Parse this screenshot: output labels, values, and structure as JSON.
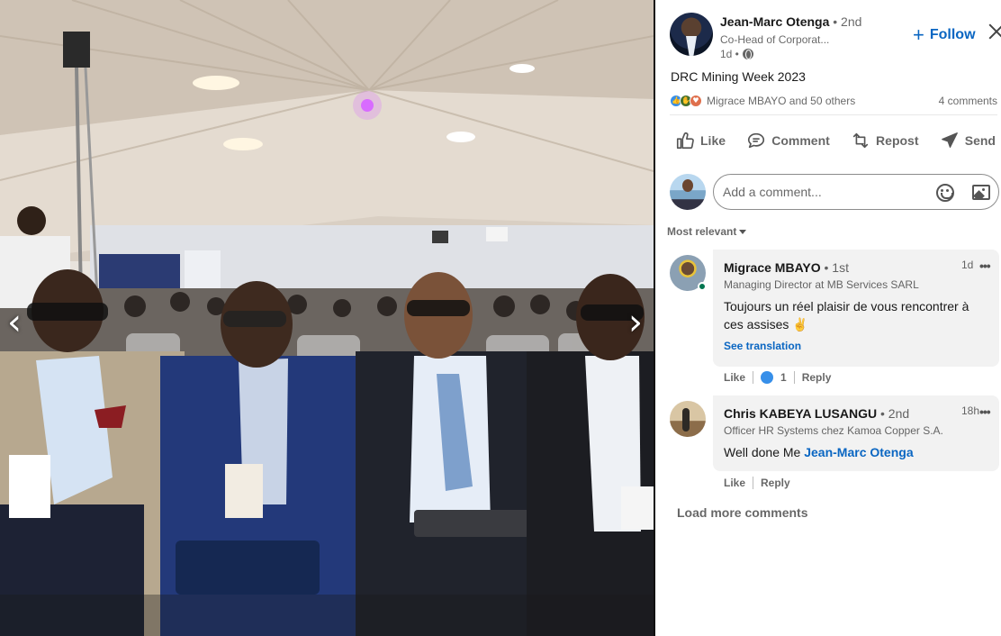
{
  "post": {
    "author_name": "Jean-Marc Otenga",
    "author_degree": "• 2nd",
    "author_title": "Co-Head of Corporat...",
    "time": "1d •",
    "follow_label": "Follow",
    "text": "DRC Mining Week 2023",
    "reactions_names": "Migrace MBAYO and 50 others",
    "comments_count": "4 comments"
  },
  "actions": {
    "like": "Like",
    "comment": "Comment",
    "repost": "Repost",
    "send": "Send"
  },
  "add_comment": {
    "placeholder": "Add a comment..."
  },
  "sort_label": "Most relevant",
  "comments": [
    {
      "name": "Migrace MBAYO",
      "degree": "• 1st",
      "headline": "Managing Director at MB Services SARL",
      "time": "1d",
      "text": "Toujours un réel plaisir de vous rencontrer à ces assises ✌",
      "see_translation": "See translation",
      "like_label": "Like",
      "like_count": "1",
      "reply_label": "Reply"
    },
    {
      "name": "Chris KABEYA LUSANGU",
      "degree": "• 2nd",
      "headline": "Officer HR Systems chez Kamoa Copper S.A.",
      "time": "18h",
      "text_prefix": "Well done Me",
      "mention": "Jean-Marc Otenga",
      "like_label": "Like",
      "reply_label": "Reply"
    }
  ],
  "load_more": "Load more comments",
  "nav": {
    "prev": "‹",
    "next": "›"
  },
  "colors": {
    "brand_blue": "#0a66c2",
    "like_blue": "#378fe9",
    "bubble_bg": "#f2f2f2"
  }
}
